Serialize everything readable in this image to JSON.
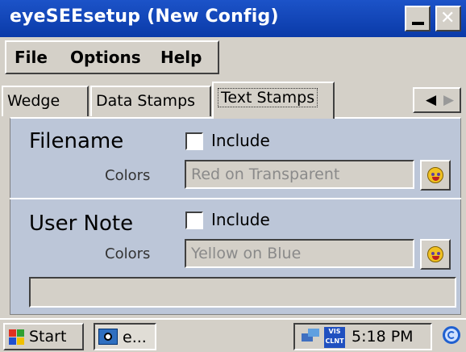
{
  "window": {
    "title": "eyeSEEsetup (New Config)"
  },
  "menubar": {
    "items": [
      "File",
      "Options",
      "Help"
    ]
  },
  "tabs": {
    "items": [
      "Wedge",
      "Data Stamps",
      "Text Stamps"
    ],
    "active": "Text Stamps"
  },
  "filename": {
    "title": "Filename",
    "include_label": "Include",
    "include_checked": false,
    "colors_label": "Colors",
    "colors_value": "Red on Transparent"
  },
  "user_note": {
    "title": "User Note",
    "include_label": "Include",
    "include_checked": false,
    "colors_label": "Colors",
    "colors_value": "Yellow on Blue"
  },
  "taskbar": {
    "start_label": "Start",
    "task_label": "e...",
    "clock": "5:18 PM"
  },
  "icons": {
    "color_picker": "smiley-icon",
    "title_close": "close-icon",
    "title_minimize": "minimize-icon"
  },
  "colors": {
    "titlebar": "#0a3aa8",
    "panel": "#bcc6d8",
    "chrome": "#d4d0c8"
  }
}
